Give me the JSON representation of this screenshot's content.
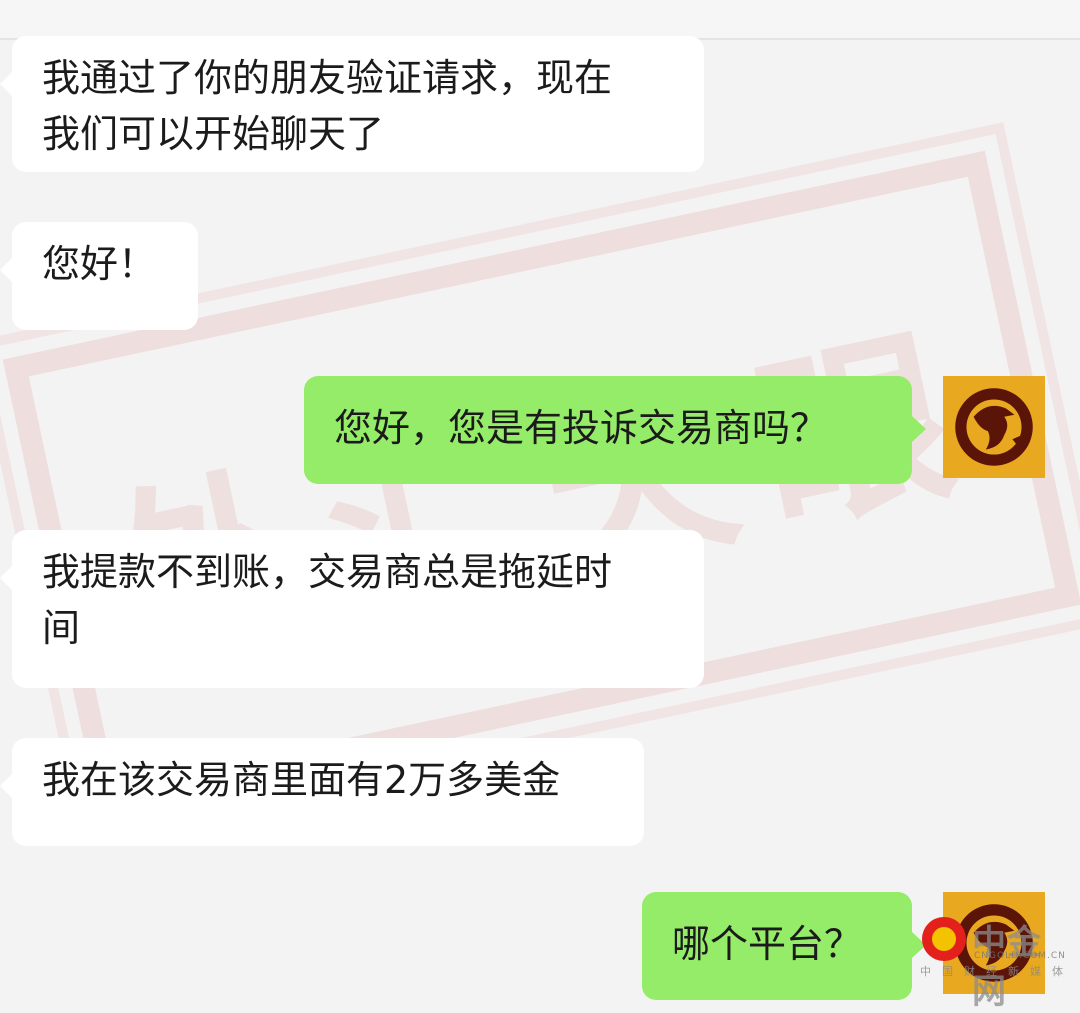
{
  "chat": {
    "messages": [
      {
        "side": "in",
        "text": "我通过了你的朋友验证请求，现在\n我们可以开始聊天了"
      },
      {
        "side": "in",
        "text": "您好！"
      },
      {
        "side": "out",
        "text": "您好，您是有投诉交易商吗？"
      },
      {
        "side": "in",
        "text": "我提款不到账，交易商总是拖延时\n间"
      },
      {
        "side": "in",
        "text": "我在该交易商里面有2万多美金"
      },
      {
        "side": "out",
        "text": "哪个平台？"
      }
    ]
  },
  "avatar": {
    "icon": "eagle-logo-icon",
    "background": "#e8a820",
    "foreground": "#5a1408"
  },
  "stamp": {
    "text": "外汇天眼",
    "color": "#d76464"
  },
  "watermark": {
    "name": "中金网",
    "url": "CNGOLD.COM.CN",
    "sub": "中国财经新媒体"
  },
  "colors": {
    "incoming_bubble": "#ffffff",
    "outgoing_bubble": "#95ec69",
    "background": "#f3f3f3"
  }
}
